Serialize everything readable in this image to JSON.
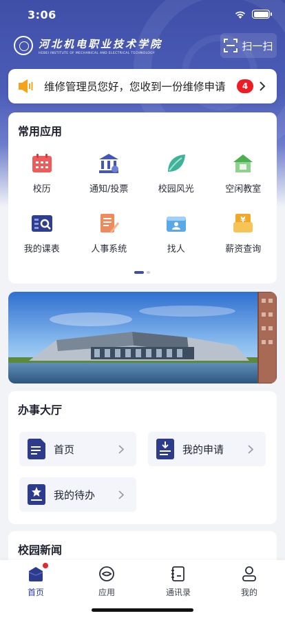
{
  "status_bar": {
    "time": "3:06"
  },
  "header": {
    "school_name_cn": "河北机电职业技术学院",
    "school_name_en": "HEBEI INSTITUTE OF MECHANICAL AND ELECTRICAL TECHNOLOGY",
    "scan_label": "扫一扫"
  },
  "notice": {
    "text": "维修管理员您好，您收到一份维修申请",
    "count": "4"
  },
  "apps": {
    "title": "常用应用",
    "items": [
      {
        "label": "校历",
        "icon": "calendar-icon",
        "color": "#ee5b5b"
      },
      {
        "label": "通知/投票",
        "icon": "bank-building-icon",
        "color": "#4457b8"
      },
      {
        "label": "校园风光",
        "icon": "leaf-icon",
        "color": "#3fb39a"
      },
      {
        "label": "空闲教室",
        "icon": "house-icon",
        "color": "#4caf50"
      },
      {
        "label": "我的课表",
        "icon": "schedule-search-icon",
        "color": "#2f3f8f"
      },
      {
        "label": "人事系统",
        "icon": "document-edit-icon",
        "color": "#ee8a5b"
      },
      {
        "label": "找人",
        "icon": "contact-card-icon",
        "color": "#5aa8e6"
      },
      {
        "label": "薪资查询",
        "icon": "salary-icon",
        "color": "#f1a826"
      }
    ],
    "page_indicator": {
      "pages": 2,
      "current": 1
    }
  },
  "banner": {
    "image": "campus-building-photo"
  },
  "service_hall": {
    "title": "办事大厅",
    "items": [
      {
        "label": "首页",
        "icon": "document-icon"
      },
      {
        "label": "我的申请",
        "icon": "application-icon"
      },
      {
        "label": "我的待办",
        "icon": "star-todo-icon"
      }
    ]
  },
  "news": {
    "title": "校园新闻"
  },
  "tabbar": {
    "items": [
      {
        "label": "首页",
        "icon": "home-icon",
        "active": true,
        "has_dot": true
      },
      {
        "label": "应用",
        "icon": "apps-icon",
        "active": false
      },
      {
        "label": "通讯录",
        "icon": "contacts-book-icon",
        "active": false
      },
      {
        "label": "我的",
        "icon": "profile-icon",
        "active": false
      }
    ]
  },
  "colors": {
    "primary": "#3d4db0",
    "badge": "#ee1c25"
  }
}
